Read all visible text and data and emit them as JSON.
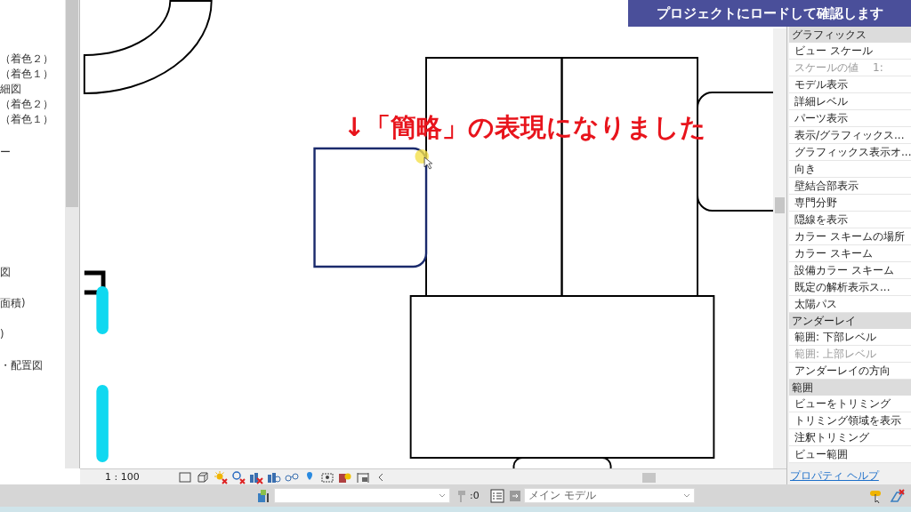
{
  "browser": {
    "items": [
      {
        "label": "（着色２）"
      },
      {
        "label": "（着色１）"
      },
      {
        "label": "細図"
      },
      {
        "label": "（着色２）"
      },
      {
        "label": "（着色１）"
      },
      {
        "label": "ー"
      },
      {
        "label": "図"
      },
      {
        "label": "面積)"
      },
      {
        "label": ")"
      },
      {
        "label": "・配置図"
      }
    ]
  },
  "banner": {
    "text": "プロジェクトにロードして確認します"
  },
  "annotation": {
    "text": "↓「簡略」の表現になりました"
  },
  "properties": {
    "groups": [
      {
        "title": "グラフィックス",
        "items": [
          {
            "label": "ビュー スケール",
            "disabled": false
          },
          {
            "label": "スケールの値",
            "value": "1:",
            "disabled": true
          },
          {
            "label": "モデル表示",
            "disabled": false
          },
          {
            "label": "詳細レベル",
            "disabled": false
          },
          {
            "label": "パーツ表示",
            "disabled": false
          },
          {
            "label": "表示/グラフィックス...",
            "disabled": false
          },
          {
            "label": "グラフィックス表示オ...",
            "disabled": false
          },
          {
            "label": "向き",
            "disabled": false
          },
          {
            "label": "壁結合部表示",
            "disabled": false
          },
          {
            "label": "専門分野",
            "disabled": false
          },
          {
            "label": "隠線を表示",
            "disabled": false
          },
          {
            "label": "カラー スキームの場所",
            "disabled": false
          },
          {
            "label": "カラー スキーム",
            "disabled": false
          },
          {
            "label": "設備カラー スキーム",
            "disabled": false
          },
          {
            "label": "既定の解析表示ス...",
            "disabled": false
          },
          {
            "label": "太陽パス",
            "disabled": false
          }
        ]
      },
      {
        "title": "アンダーレイ",
        "items": [
          {
            "label": "範囲: 下部レベル",
            "disabled": false
          },
          {
            "label": "範囲: 上部レベル",
            "disabled": true
          },
          {
            "label": "アンダーレイの方向",
            "disabled": false
          }
        ]
      },
      {
        "title": "範囲",
        "items": [
          {
            "label": "ビューをトリミング",
            "disabled": false
          },
          {
            "label": "トリミング領域を表示",
            "disabled": false
          },
          {
            "label": "注釈トリミング",
            "disabled": false
          },
          {
            "label": "ビュー範囲",
            "disabled": false
          }
        ]
      }
    ],
    "help_link": "プロパティ ヘルプ"
  },
  "view_bar": {
    "scale": "1 : 100"
  },
  "status_bar": {
    "count": ":0",
    "model": "メイン モデル"
  }
}
